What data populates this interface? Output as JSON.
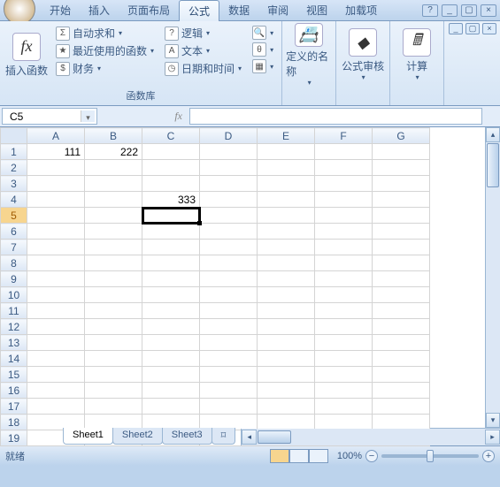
{
  "tabs": {
    "items": [
      "开始",
      "插入",
      "页面布局",
      "公式",
      "数据",
      "审阅",
      "视图",
      "加载项"
    ],
    "active_index": 3
  },
  "ribbon": {
    "insert_fn": {
      "label": "插入函数",
      "fx": "fx"
    },
    "funclib": {
      "title": "函数库",
      "autosum": "自动求和",
      "recent": "最近使用的函数",
      "financial": "财务",
      "logical": "逻辑",
      "text": "文本",
      "datetime": "日期和时间"
    },
    "defined_names": {
      "label": "定义的名称"
    },
    "formula_audit": {
      "label": "公式审核"
    },
    "calculation": {
      "label": "计算"
    }
  },
  "formula_bar": {
    "name_box": "C5",
    "fx": "fx",
    "value": ""
  },
  "grid": {
    "columns": [
      "A",
      "B",
      "C",
      "D",
      "E",
      "F",
      "G"
    ],
    "row_count": 19,
    "selected_row": 5,
    "selected_col": "C",
    "cells": {
      "A1": "111",
      "B1": "222",
      "C4": "333"
    }
  },
  "sheets": {
    "items": [
      "Sheet1",
      "Sheet2",
      "Sheet3"
    ],
    "active_index": 0
  },
  "status": {
    "ready": "就绪",
    "zoom": "100%"
  }
}
